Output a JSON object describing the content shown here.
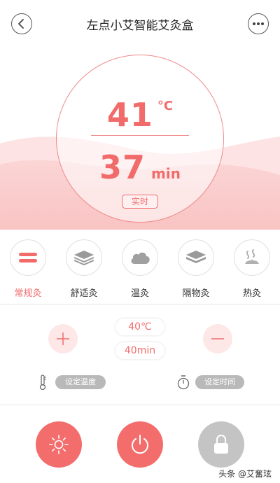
{
  "header": {
    "title": "左点小艾智能艾灸盒",
    "back_icon": "chevron-left-icon",
    "more_icon": "more-dots-icon"
  },
  "colors": {
    "accent": "#f26b6b",
    "wave": "#f9c6c6",
    "disabled": "#c4c4c4"
  },
  "display": {
    "temperature": "41",
    "temperature_unit": "°C",
    "time": "37",
    "time_unit": "min",
    "status_badge": "实时"
  },
  "modes": [
    {
      "label": "常规灸",
      "icon": "layers-icon",
      "active": true
    },
    {
      "label": "舒适灸",
      "icon": "layers-stack-icon",
      "active": false
    },
    {
      "label": "温灸",
      "icon": "cloud-icon",
      "active": false
    },
    {
      "label": "隔物灸",
      "icon": "pad-icon",
      "active": false
    },
    {
      "label": "热灸",
      "icon": "heat-waves-icon",
      "active": false
    }
  ],
  "settings": {
    "temp_value": "40℃",
    "time_value": "40min",
    "temp_label": "设定温度",
    "time_label": "设定时间"
  },
  "watermark": "头条 @艾奮玹"
}
